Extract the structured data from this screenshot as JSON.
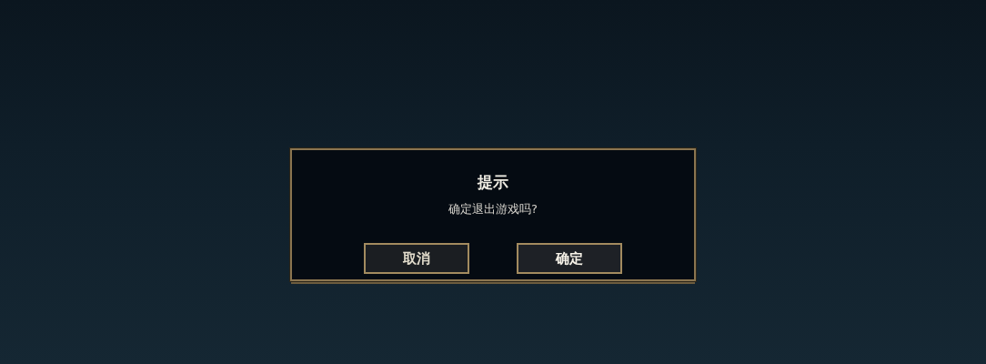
{
  "dialog": {
    "title": "提示",
    "message": "确定退出游戏吗?",
    "buttons": [
      {
        "label": "取消",
        "kind": "cancel"
      },
      {
        "label": "确定",
        "kind": "confirm"
      }
    ]
  }
}
